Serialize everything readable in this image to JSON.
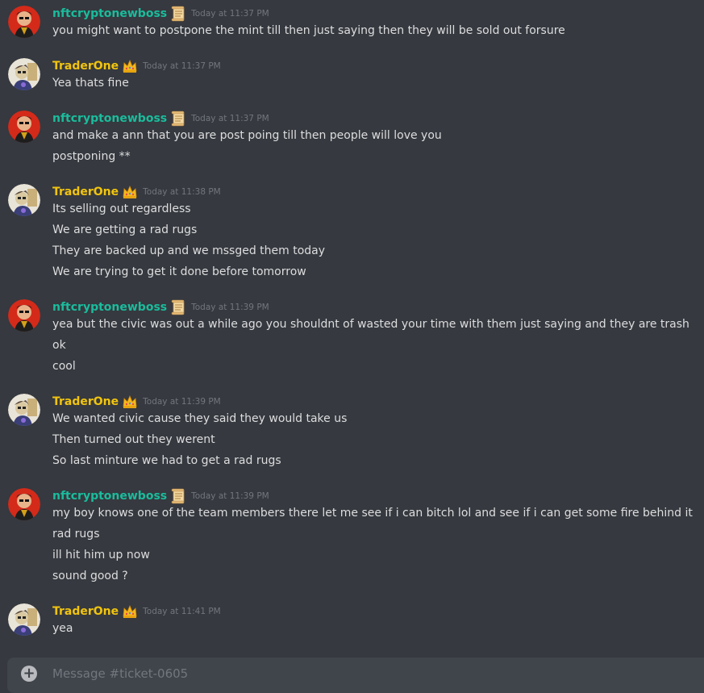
{
  "messages": [
    {
      "user": "nftcryptonewboss",
      "color": "teal",
      "badge": "scroll-icon",
      "time": "Today at 11:37 PM",
      "lines": [
        "you might want to postpone the mint till then just saying then they will be sold out forsure"
      ]
    },
    {
      "user": "TraderOne",
      "color": "gold",
      "badge": "crown-icon",
      "time": "Today at 11:37 PM",
      "lines": [
        "Yea thats fine"
      ]
    },
    {
      "user": "nftcryptonewboss",
      "color": "teal",
      "badge": "scroll-icon",
      "time": "Today at 11:37 PM",
      "lines": [
        "and make a ann that you are post poing till then people will love you",
        "postponing  **"
      ]
    },
    {
      "user": "TraderOne",
      "color": "gold",
      "badge": "crown-icon",
      "time": "Today at 11:38 PM",
      "lines": [
        "Its selling out regardless",
        "We are getting a rad rugs",
        "They are backed up and we mssged them today",
        "We are trying to get it done before tomorrow"
      ]
    },
    {
      "user": "nftcryptonewboss",
      "color": "teal",
      "badge": "scroll-icon",
      "time": "Today at 11:39 PM",
      "lines": [
        "yea but the civic was out a while ago you shouldnt of wasted your time with them just saying and they are trash",
        "ok",
        "cool"
      ]
    },
    {
      "user": "TraderOne",
      "color": "gold",
      "badge": "crown-icon",
      "time": "Today at 11:39 PM",
      "lines": [
        "We wanted civic cause they said they would take us",
        "Then turned out they werent",
        "So last minture we had to get a rad rugs"
      ]
    },
    {
      "user": "nftcryptonewboss",
      "color": "teal",
      "badge": "scroll-icon",
      "time": "Today at 11:39 PM",
      "lines": [
        "my boy knows one of the team members there let me see if i can bitch lol and see if i can get some fire behind it",
        "rad rugs",
        "ill hit him up now",
        "sound good ?"
      ]
    },
    {
      "user": "TraderOne",
      "color": "gold",
      "badge": "crown-icon",
      "time": "Today at 11:41 PM",
      "lines": [
        "yea"
      ]
    }
  ],
  "composer": {
    "placeholder": "Message #ticket-0605"
  }
}
